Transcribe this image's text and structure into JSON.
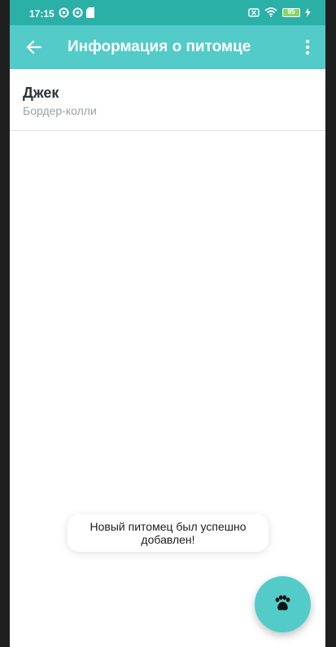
{
  "status_bar": {
    "time": "17:15",
    "battery": "95"
  },
  "toolbar": {
    "title": "Информация о питомце"
  },
  "pet": {
    "name": "Джек",
    "breed": "Бордер-колли"
  },
  "toast": {
    "message": "Новый питомец был успешно добавлен!"
  },
  "colors": {
    "status_bar": "#2bb0a8",
    "toolbar": "#52cbc9",
    "fab": "#52cbc9"
  },
  "icons": {
    "back": "arrow-back-icon",
    "menu": "more-vert-icon",
    "fab": "paw-icon"
  }
}
